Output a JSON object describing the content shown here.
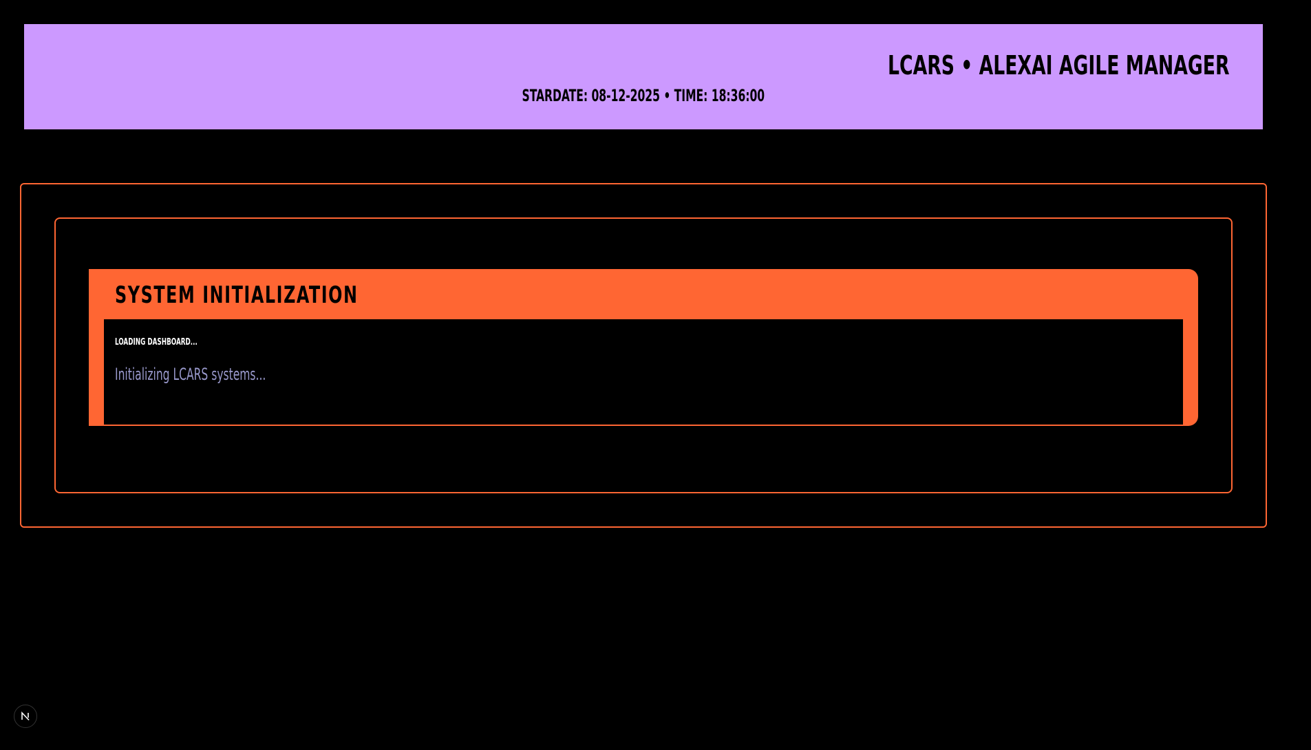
{
  "header": {
    "title": "LCARS • ALEXAI AGILE MANAGER",
    "stardate": "STARDATE: 08-12-2025 • TIME: 18:36:00"
  },
  "panel": {
    "title": "SYSTEM INITIALIZATION",
    "loading_label": "LOADING DASHBOARD...",
    "loading_message": "Initializing LCARS systems..."
  },
  "colors": {
    "header_bg": "#cc99ff",
    "accent": "#ff6633",
    "muted_text": "#9999cc",
    "background": "#000000"
  },
  "icons": {
    "dev_badge": "nextjs-logo-icon"
  }
}
